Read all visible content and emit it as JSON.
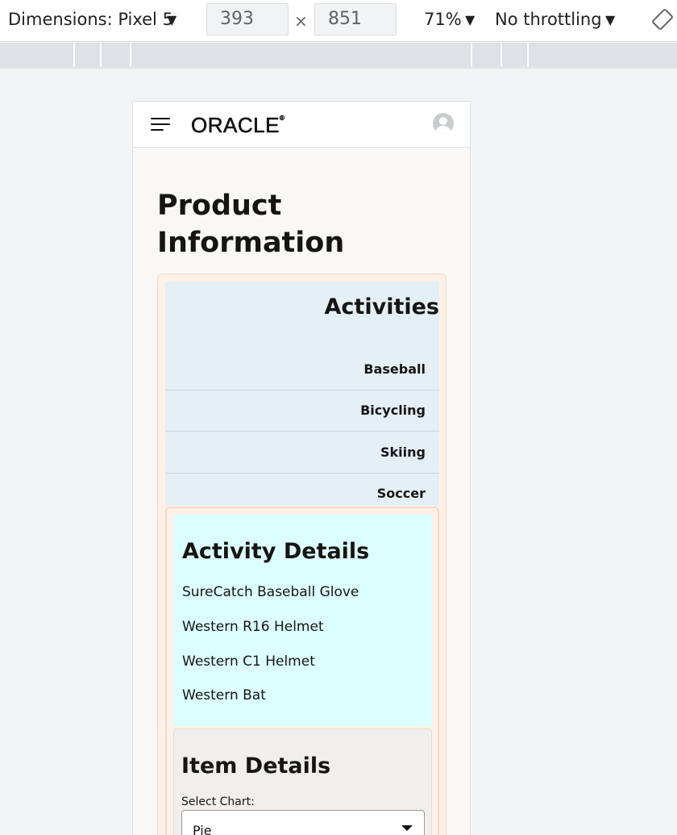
{
  "devtools": {
    "dimensions_label": "Dimensions: Pixel 5",
    "width_value": "393",
    "height_value": "851",
    "times": "×",
    "zoom": "71%",
    "throttling": "No throttling",
    "arrow": "▼"
  },
  "app": {
    "logo": "ORACLE",
    "logo_reg": "®"
  },
  "page": {
    "title_line1": "Product",
    "title_line2": "Information"
  },
  "activities": {
    "heading": "Activities",
    "items": [
      {
        "label": "Baseball"
      },
      {
        "label": "Bicycling"
      },
      {
        "label": "Skiing"
      },
      {
        "label": "Soccer"
      }
    ]
  },
  "activity_details": {
    "heading": "Activity Details",
    "items": [
      {
        "label": "SureCatch Baseball Glove"
      },
      {
        "label": "Western R16 Helmet"
      },
      {
        "label": "Western C1 Helmet"
      },
      {
        "label": "Western Bat"
      }
    ]
  },
  "item_details": {
    "heading": "Item Details",
    "select_label": "Select Chart:",
    "select_value": "Pie"
  }
}
